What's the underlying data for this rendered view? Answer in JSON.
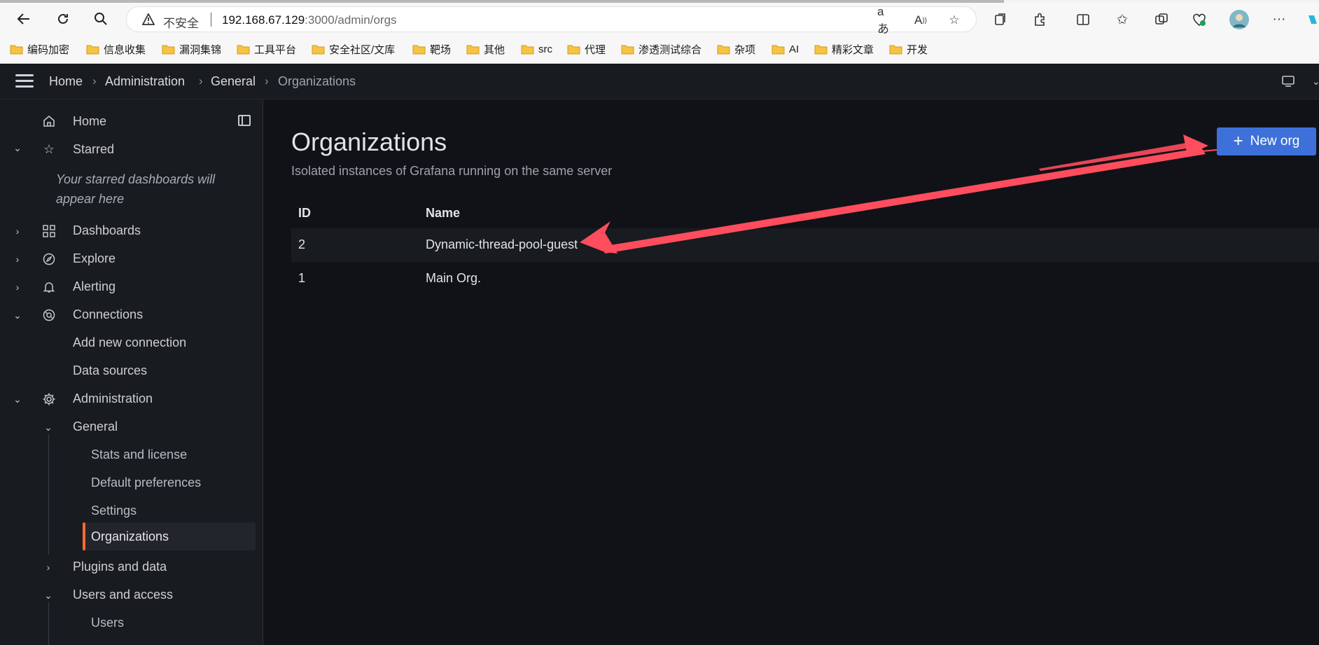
{
  "browser": {
    "insecure_label": "不安全",
    "url_host": "192.168.67.129",
    "url_rest": ":3000/admin/orgs",
    "bookmarks": [
      "编码加密",
      "信息收集",
      "漏洞集锦",
      "工具平台",
      "安全社区/文库",
      "靶场",
      "其他",
      "src",
      "代理",
      "渗透测试综合",
      "杂项",
      "AI",
      "精彩文章",
      "开发"
    ]
  },
  "breadcrumb": [
    "Home",
    "Administration",
    "General",
    "Organizations"
  ],
  "sidebar": {
    "home": "Home",
    "starred": "Starred",
    "starred_empty": "Your starred dashboards will appear here",
    "dashboards": "Dashboards",
    "explore": "Explore",
    "alerting": "Alerting",
    "connections": "Connections",
    "add_new_connection": "Add new connection",
    "data_sources": "Data sources",
    "administration": "Administration",
    "general": "General",
    "stats_and_license": "Stats and license",
    "default_preferences": "Default preferences",
    "settings": "Settings",
    "organizations": "Organizations",
    "plugins_and_data": "Plugins and data",
    "users_and_access": "Users and access",
    "users": "Users"
  },
  "page": {
    "title": "Organizations",
    "subtitle": "Isolated instances of Grafana running on the same server",
    "new_org_label": "New org",
    "columns": [
      "ID",
      "Name"
    ],
    "rows": [
      {
        "id": "2",
        "name": "Dynamic-thread-pool-guest"
      },
      {
        "id": "1",
        "name": "Main Org."
      }
    ],
    "delete_symbol": "×"
  },
  "colors": {
    "accent_primary": "#3d71d9",
    "danger": "#d10e5c",
    "active_indicator": "#f76c2f",
    "annotation_arrow": "#ff4d5e"
  }
}
